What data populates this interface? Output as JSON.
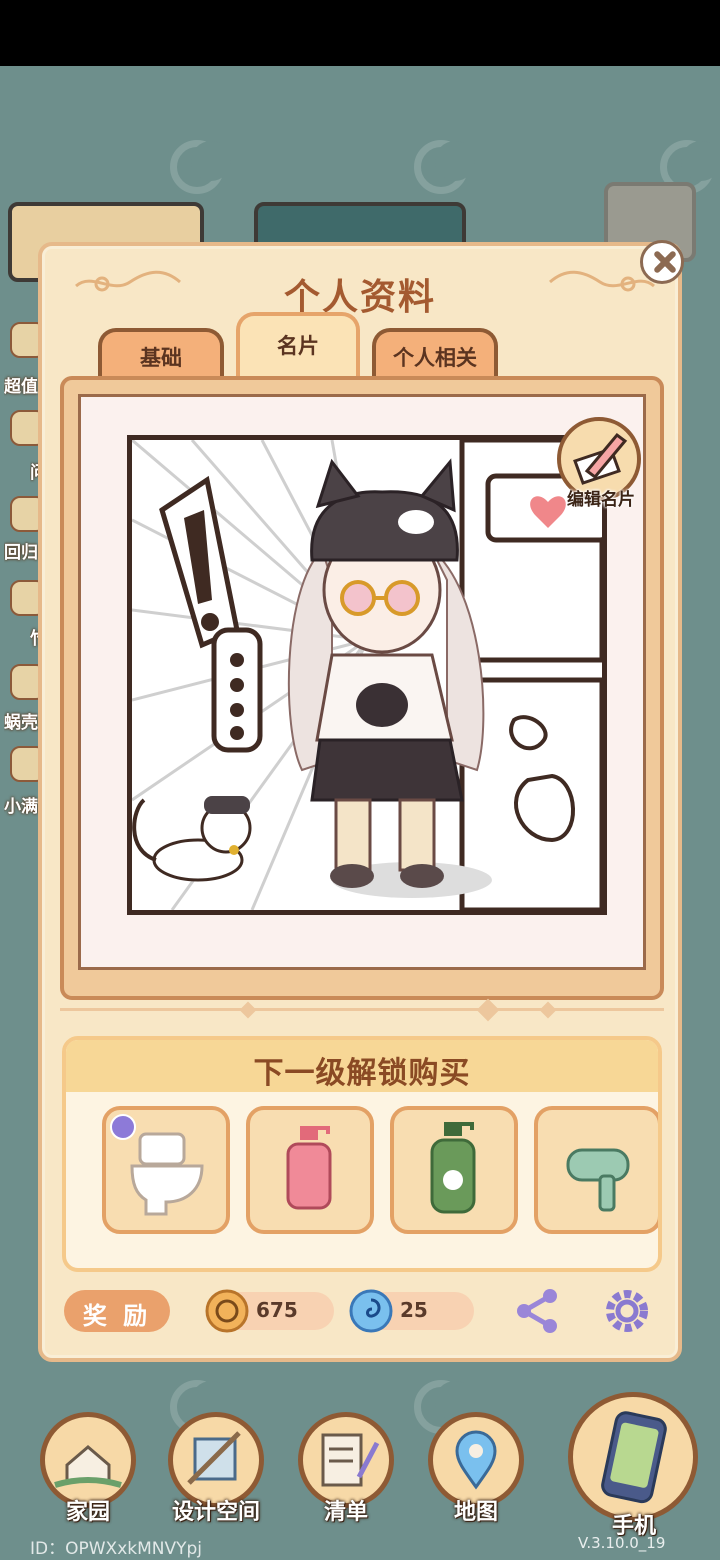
{
  "modal": {
    "title": "个人资料",
    "tabs": [
      {
        "label": "基础",
        "active": false
      },
      {
        "label": "名片",
        "active": true
      },
      {
        "label": "个人相关",
        "active": false
      }
    ],
    "edit_card_label": "编辑名片"
  },
  "unlock": {
    "title": "下一级解锁购买",
    "items": [
      {
        "icon": "toilet-icon",
        "locked_badge": true
      },
      {
        "icon": "pink-soap-bottle-icon",
        "locked_badge": false
      },
      {
        "icon": "green-soap-bottle-icon",
        "locked_badge": false
      },
      {
        "icon": "hair-dryer-icon",
        "locked_badge": false
      }
    ]
  },
  "rewards": {
    "button_label": "奖 励",
    "coin_value": "675",
    "gem_value": "25"
  },
  "background_side_items": [
    "超值",
    "问",
    "回归",
    "竹",
    "蜗壳",
    "小满"
  ],
  "nav": {
    "items": [
      "家园",
      "设计空间",
      "清单",
      "地图"
    ],
    "phone_label": "手机"
  },
  "footer": {
    "player_id": "ID：OPWXxkMNVYpj",
    "version": "V.3.10.0_19"
  },
  "colors": {
    "background": "#6e8f8c",
    "modal_bg": "#f8e7c6",
    "title": "#a45a30",
    "tab": "#f4b07a",
    "accent_brown": "#8e5a34"
  }
}
